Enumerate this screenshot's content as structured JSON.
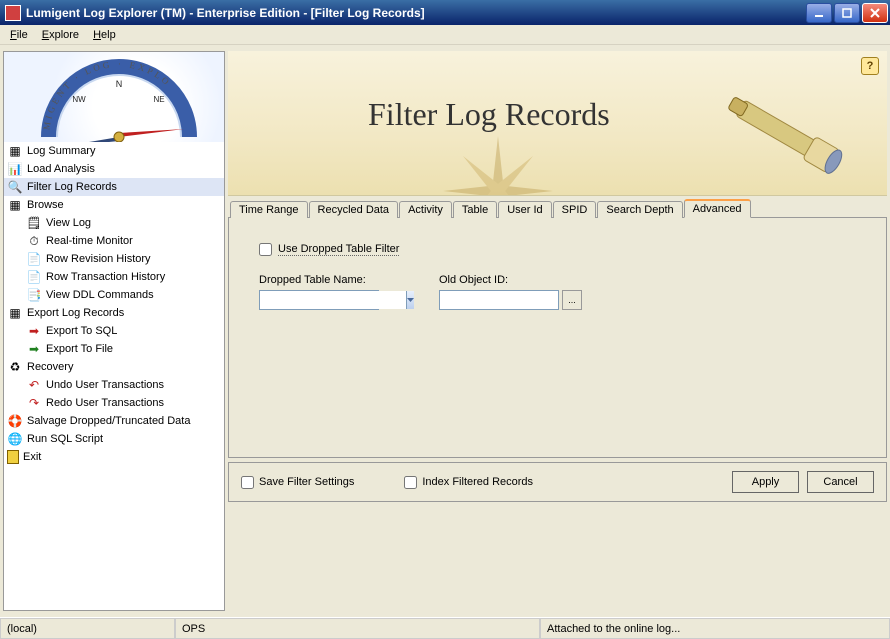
{
  "titlebar": {
    "title": "Lumigent Log Explorer (TM) - Enterprise Edition - [Filter Log Records]"
  },
  "menu": {
    "file": "File",
    "explore": "Explore",
    "help": "Help"
  },
  "sidebar": {
    "items": [
      {
        "label": "Log Summary"
      },
      {
        "label": "Load Analysis"
      },
      {
        "label": "Filter Log Records"
      },
      {
        "label": "Browse"
      },
      {
        "label": "View Log"
      },
      {
        "label": "Real-time Monitor"
      },
      {
        "label": "Row Revision History"
      },
      {
        "label": "Row Transaction History"
      },
      {
        "label": "View DDL Commands"
      },
      {
        "label": "Export Log Records"
      },
      {
        "label": "Export To SQL"
      },
      {
        "label": "Export To File"
      },
      {
        "label": "Recovery"
      },
      {
        "label": "Undo User Transactions"
      },
      {
        "label": "Redo User Transactions"
      },
      {
        "label": "Salvage Dropped/Truncated Data"
      },
      {
        "label": "Run SQL Script"
      },
      {
        "label": "Exit"
      }
    ]
  },
  "banner": {
    "title": "Filter Log Records"
  },
  "tabs": {
    "items": [
      {
        "label": "Time Range"
      },
      {
        "label": "Recycled Data"
      },
      {
        "label": "Activity"
      },
      {
        "label": "Table"
      },
      {
        "label": "User Id"
      },
      {
        "label": "SPID"
      },
      {
        "label": "Search Depth"
      },
      {
        "label": "Advanced"
      }
    ]
  },
  "advanced": {
    "use_dropped_filter": "Use Dropped Table Filter",
    "dropped_table_name": "Dropped Table Name:",
    "old_object_id": "Old Object ID:",
    "dropped_value": "",
    "objectid_value": "",
    "browse": "..."
  },
  "footer": {
    "save_filter": "Save Filter Settings",
    "index_filtered": "Index Filtered Records",
    "apply": "Apply",
    "cancel": "Cancel"
  },
  "status": {
    "left": "(local)",
    "mid": "OPS",
    "right": "Attached to the online log..."
  }
}
